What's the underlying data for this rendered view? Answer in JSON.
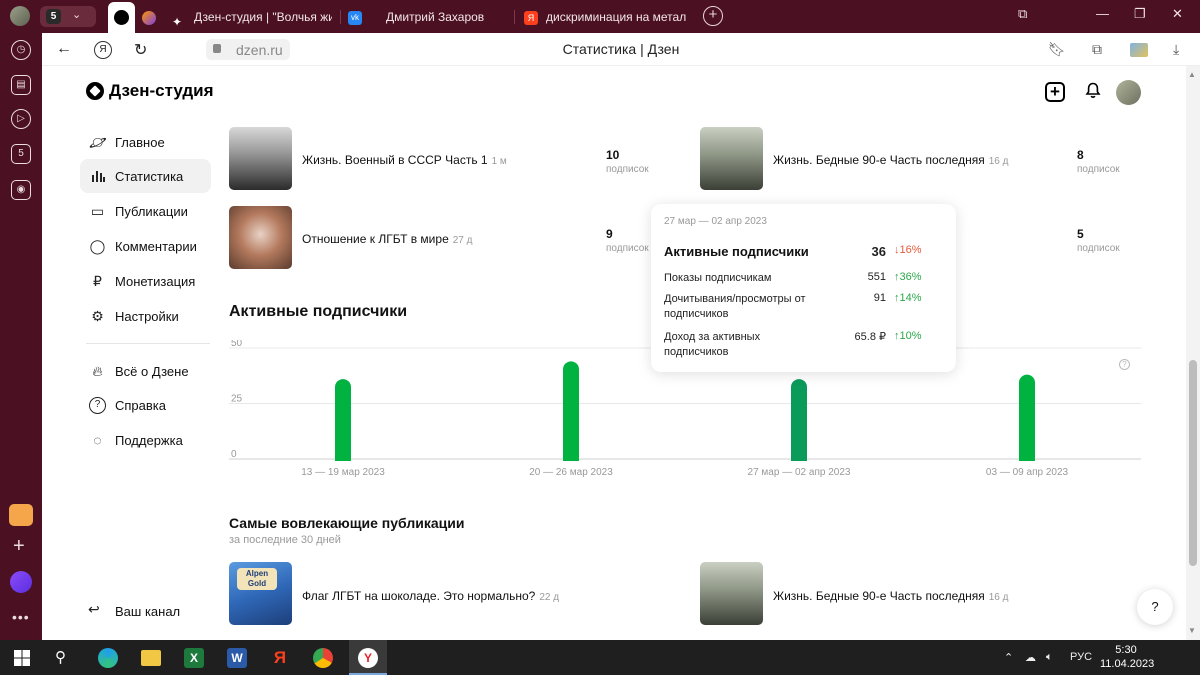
{
  "browser": {
    "tabs": [
      {
        "label": "Дзен-студия | \"Волчья жи"
      },
      {
        "label": "Дмитрий Захаров"
      },
      {
        "label": "дискриминация на метал"
      }
    ],
    "address": {
      "url": "dzen.ru",
      "page_title": "Статистика | Дзен"
    },
    "colors": {
      "chrome": "#4b1021"
    }
  },
  "header": {
    "brand": "Дзен-студия"
  },
  "sidebar": {
    "items": [
      {
        "label": "Главное",
        "icon": "planet-icon"
      },
      {
        "label": "Статистика",
        "icon": "bar-chart-icon",
        "active": true
      },
      {
        "label": "Публикации",
        "icon": "publications-icon"
      },
      {
        "label": "Комментарии",
        "icon": "comment-icon"
      },
      {
        "label": "Монетизация",
        "icon": "ruble-icon"
      },
      {
        "label": "Настройки",
        "icon": "gear-icon"
      }
    ],
    "secondary": [
      {
        "label": "Всё о Дзене",
        "icon": "flame-icon"
      },
      {
        "label": "Справка",
        "icon": "question-icon"
      },
      {
        "label": "Поддержка",
        "icon": "support-icon"
      }
    ],
    "your_channel": "Ваш канал"
  },
  "top_publications": [
    {
      "title": "Жизнь. Военный в СССР Часть 1",
      "age": "1 м",
      "subscribers": "10",
      "subs_label": "подписок"
    },
    {
      "title": "Жизнь. Бедные 90-е Часть последняя",
      "age": "16 д",
      "subscribers": "8",
      "subs_label": "подписок"
    },
    {
      "title": "Отношение к ЛГБТ в мире",
      "age": "27 д",
      "subscribers": "9",
      "subs_label": "подписок"
    },
    {
      "title": "",
      "age": "",
      "subscribers": "5",
      "subs_label": "подписок"
    }
  ],
  "active_subscribers": {
    "title": "Активные подписчики",
    "help": "?"
  },
  "chart_data": {
    "type": "bar",
    "title": "Активные подписчики",
    "categories": [
      "13 — 19 мар 2023",
      "20 — 26 мар 2023",
      "27 мар — 02 апр 2023",
      "03 — 09 апр 2023"
    ],
    "values": [
      36,
      44,
      36,
      38
    ],
    "ylim": [
      0,
      50
    ],
    "yticks": [
      "0",
      "25",
      "50"
    ],
    "highlighted_index": 2,
    "colors": {
      "bar": "#00b341",
      "bar_highlight": "#0a9a5a",
      "grid": "#e8e8e8"
    }
  },
  "tooltip": {
    "date": "27 мар — 02 апр 2023",
    "main": {
      "label": "Активные подписчики",
      "value": "36",
      "delta": "16%",
      "direction": "down"
    },
    "rows": [
      {
        "label": "Показы подписчикам",
        "value": "551",
        "delta": "36%",
        "direction": "up"
      },
      {
        "label": "Дочитывания/просмотры от подписчиков",
        "value": "91",
        "delta": "14%",
        "direction": "up"
      },
      {
        "label": "Доход за активных подписчиков",
        "value": "65.8 ₽",
        "delta": "10%",
        "direction": "up"
      }
    ]
  },
  "engaging": {
    "title": "Самые вовлекающие публикации",
    "subtitle": "за последние 30 дней",
    "items": [
      {
        "title": "Флаг ЛГБТ на шоколаде. Это нормально?",
        "age": "22 д",
        "thumb_text": "Alpen Gold"
      },
      {
        "title": "Жизнь. Бедные 90-е Часть последняя",
        "age": "16 д"
      }
    ]
  },
  "help_fab": "?",
  "taskbar": {
    "lang": "РУС",
    "time": "5:30",
    "date": "11.04.2023"
  }
}
